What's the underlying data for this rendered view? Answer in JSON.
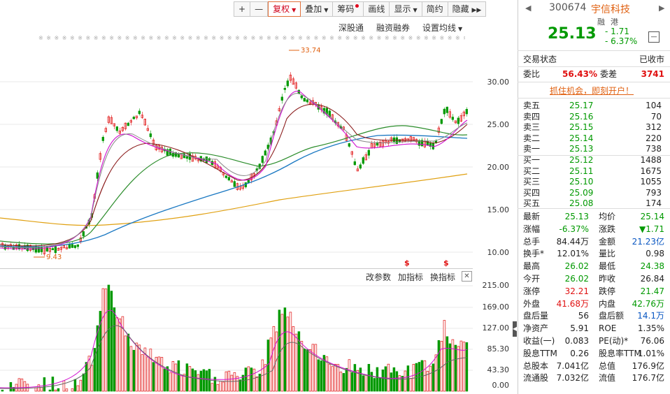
{
  "toolbar": {
    "buttons": [
      "+",
      "—",
      "复权",
      "叠加",
      "筹码",
      "画线",
      "显示",
      "简约",
      "隐藏"
    ],
    "more": "▶▶"
  },
  "subbar": {
    "items": [
      "深股通",
      "融资融券",
      "设置均线"
    ]
  },
  "price_chart": {
    "annot_high": "33.74",
    "annot_low": "9.43",
    "y_ticks": [
      "30.00",
      "25.00",
      "20.00",
      "15.00",
      "10.00"
    ]
  },
  "vol_chart": {
    "y_ticks": [
      "215.00",
      "169.00",
      "127.00",
      "85.30",
      "43.30",
      "0.00"
    ],
    "marker": "$"
  },
  "midbar": {
    "items": [
      "改参数",
      "加指标",
      "换指标"
    ],
    "close": "✕"
  },
  "stock": {
    "code": "300674",
    "name": "宇信科技",
    "tags": [
      "融",
      "港"
    ],
    "price": "25.13",
    "change": "- 1.71",
    "change_pct": "- 6.37%",
    "minus_btn": "—",
    "status_label": "交易状态",
    "status_value": "已收市",
    "weibi_label": "委比",
    "weibi_value": "56.43%",
    "weicha_label": "委差",
    "weicha_value": "3741",
    "promo": "抓住机会，即刻开户！"
  },
  "order_book": {
    "sell": [
      {
        "label": "卖五",
        "price": "25.17",
        "vol": "104"
      },
      {
        "label": "卖四",
        "price": "25.16",
        "vol": "70"
      },
      {
        "label": "卖三",
        "price": "25.15",
        "vol": "312"
      },
      {
        "label": "卖二",
        "price": "25.14",
        "vol": "220"
      },
      {
        "label": "卖一",
        "price": "25.13",
        "vol": "738"
      }
    ],
    "buy": [
      {
        "label": "买一",
        "price": "25.12",
        "vol": "1488"
      },
      {
        "label": "买二",
        "price": "25.11",
        "vol": "1675"
      },
      {
        "label": "买三",
        "price": "25.10",
        "vol": "1055"
      },
      {
        "label": "买四",
        "price": "25.09",
        "vol": "793"
      },
      {
        "label": "买五",
        "price": "25.08",
        "vol": "174"
      }
    ]
  },
  "stats": [
    {
      "l1": "最新",
      "v1": "25.13",
      "c1": "green",
      "l2": "均价",
      "v2": "25.14",
      "c2": "green"
    },
    {
      "l1": "涨幅",
      "v1": "-6.37%",
      "c1": "green",
      "l2": "涨跌",
      "v2": "▼1.71",
      "c2": "green"
    },
    {
      "l1": "总手",
      "v1": "84.44万",
      "c1": "",
      "l2": "金额",
      "v2": "21.23亿",
      "c2": "blue"
    },
    {
      "l1": "换手*",
      "v1": "12.01%",
      "c1": "",
      "l2": "量比",
      "v2": "0.98",
      "c2": ""
    },
    {
      "l1": "最高",
      "v1": "26.02",
      "c1": "green",
      "l2": "最低",
      "v2": "24.38",
      "c2": "green"
    },
    {
      "l1": "今开",
      "v1": "26.02",
      "c1": "green",
      "l2": "昨收",
      "v2": "26.84",
      "c2": ""
    },
    {
      "l1": "涨停",
      "v1": "32.21",
      "c1": "red",
      "l2": "跌停",
      "v2": "21.47",
      "c2": "green"
    },
    {
      "l1": "外盘",
      "v1": "41.68万",
      "c1": "red",
      "l2": "内盘",
      "v2": "42.76万",
      "c2": "green"
    },
    {
      "l1": "盘后量",
      "v1": "56",
      "c1": "",
      "l2": "盘后额",
      "v2": "14.1万",
      "c2": "blue"
    },
    {
      "l1": "净资产",
      "v1": "5.91",
      "c1": "",
      "l2": "ROE",
      "v2": "1.35%",
      "c2": ""
    },
    {
      "l1": "收益(一)",
      "v1": "0.083",
      "c1": "",
      "l2": "PE(动)*",
      "v2": "76.06",
      "c2": ""
    },
    {
      "l1": "股息TTM",
      "v1": "0.26",
      "c1": "",
      "l2": "股息率TTM",
      "v2": "1.01%",
      "c2": ""
    },
    {
      "l1": "总股本",
      "v1": "7.041亿",
      "c1": "",
      "l2": "总值",
      "v2": "176.9亿",
      "c2": ""
    },
    {
      "l1": "流通股",
      "v1": "7.032亿",
      "c1": "",
      "l2": "流值",
      "v2": "176.7亿",
      "c2": ""
    }
  ],
  "colors": {
    "up": "#e01010",
    "down": "#009900",
    "accent": "#e06010"
  }
}
